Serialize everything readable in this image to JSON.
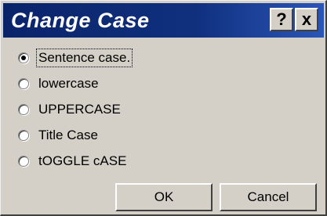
{
  "dialog": {
    "title": "Change Case",
    "help_label": "?",
    "close_label": "x"
  },
  "options": [
    {
      "label": "Sentence case.",
      "selected": true
    },
    {
      "label": "lowercase",
      "selected": false
    },
    {
      "label": "UPPERCASE",
      "selected": false
    },
    {
      "label": "Title Case",
      "selected": false
    },
    {
      "label": "tOGGLE cASE",
      "selected": false
    }
  ],
  "buttons": {
    "ok_label": "OK",
    "cancel_label": "Cancel"
  },
  "colors": {
    "titlebar_start": "#0a246a",
    "titlebar_end": "#2a56b8",
    "face": "#d4d0c8"
  }
}
